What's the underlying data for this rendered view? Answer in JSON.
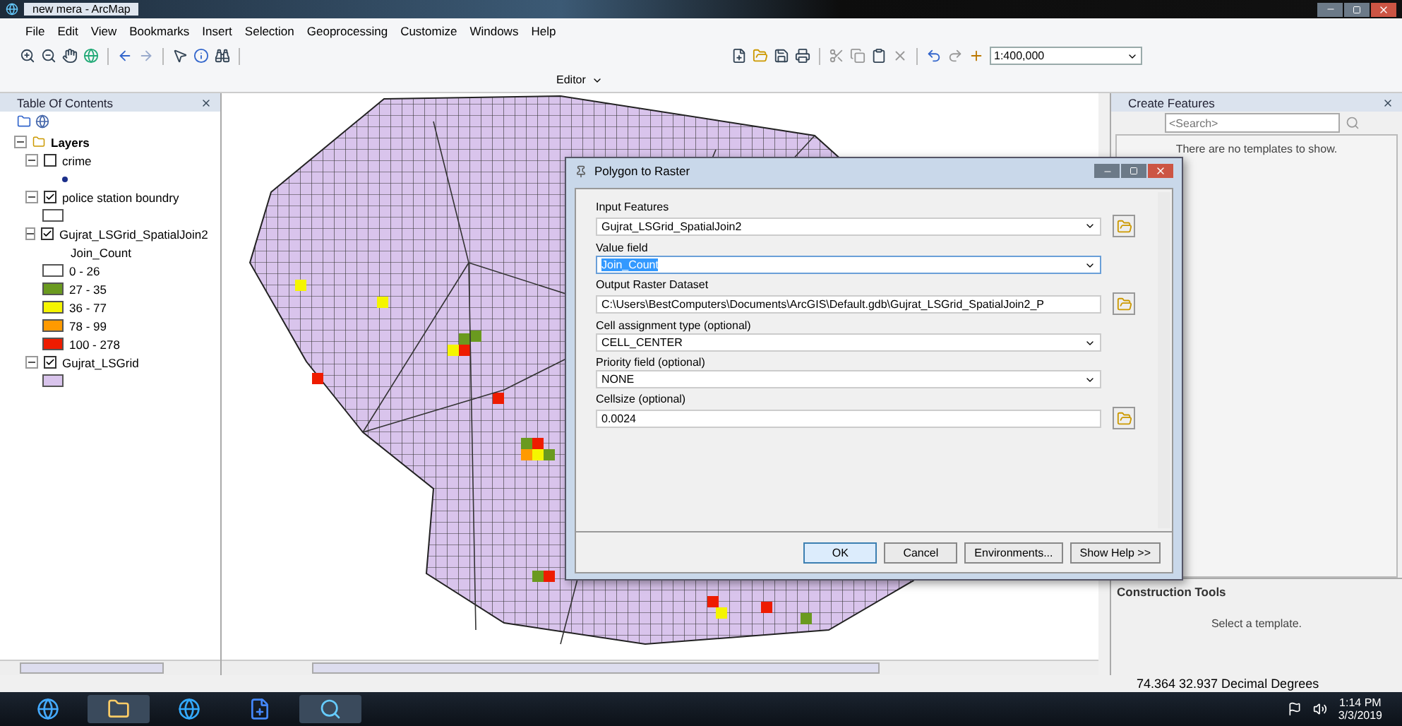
{
  "window": {
    "title": "new mera - ArcMap"
  },
  "menu": [
    "File",
    "Edit",
    "View",
    "Bookmarks",
    "Insert",
    "Selection",
    "Geoprocessing",
    "Customize",
    "Windows",
    "Help"
  ],
  "toolbar": {
    "scale": "1:400,000"
  },
  "editor_toolbar": {
    "label": "Editor"
  },
  "toc": {
    "title": "Table Of Contents",
    "root": {
      "label": "Layers",
      "expanded": true,
      "children": [
        {
          "label": "crime",
          "checked": false,
          "legend": [
            {
              "kind": "point",
              "color": "#1b2f8a"
            }
          ]
        },
        {
          "label": "police station boundry",
          "checked": true,
          "legend": [
            {
              "kind": "outline",
              "color": "#ffffff"
            }
          ]
        },
        {
          "label": "Gujrat_LSGrid_SpatialJoin2",
          "checked": true,
          "field": "Join_Count",
          "legend": [
            {
              "kind": "fill",
              "label": "0 - 26",
              "color": "#ffffff"
            },
            {
              "kind": "fill",
              "label": "27 - 35",
              "color": "#6a9a1f"
            },
            {
              "kind": "fill",
              "label": "36 - 77",
              "color": "#f5f500"
            },
            {
              "kind": "fill",
              "label": "78 - 99",
              "color": "#ff9a00"
            },
            {
              "kind": "fill",
              "label": "100 - 278",
              "color": "#ee1c00"
            }
          ]
        },
        {
          "label": "Gujrat_LSGrid",
          "checked": true,
          "legend": [
            {
              "kind": "fill",
              "color": "#d9c4ec"
            }
          ]
        }
      ]
    }
  },
  "dialog": {
    "title": "Polygon to Raster",
    "fields": [
      {
        "label": "Input Features",
        "value": "Gujrat_LSGrid_SpatialJoin2",
        "kind": "dropdown",
        "browse": true,
        "text_selected": false
      },
      {
        "label": "Value field",
        "value": "Join_Count",
        "kind": "dropdown",
        "browse": false,
        "text_selected": true
      },
      {
        "label": "Output Raster Dataset",
        "value": "C:\\Users\\BestComputers\\Documents\\ArcGIS\\Default.gdb\\Gujrat_LSGrid_SpatialJoin2_P",
        "kind": "text",
        "browse": true,
        "text_selected": false
      },
      {
        "label": "Cell assignment type (optional)",
        "value": "CELL_CENTER",
        "kind": "dropdown",
        "browse": false,
        "text_selected": false
      },
      {
        "label": "Priority field (optional)",
        "value": "NONE",
        "kind": "dropdown",
        "browse": false,
        "text_selected": false
      },
      {
        "label": "Cellsize (optional)",
        "value": "0.0024",
        "kind": "text",
        "browse": true,
        "text_selected": false
      }
    ],
    "buttons": [
      {
        "label": "OK",
        "default": true
      },
      {
        "label": "Cancel",
        "default": false
      },
      {
        "label": "Environments...",
        "default": false
      },
      {
        "label": "Show Help >>",
        "default": false
      }
    ]
  },
  "create_features": {
    "title": "Create Features",
    "search": {
      "placeholder": "<Search>"
    },
    "message": "There are no templates to show.",
    "construction_title": "Construction Tools",
    "construction_message": "Select a template."
  },
  "status_bar": {
    "coordinates": "74.364  32.937 Decimal Degrees"
  },
  "taskbar": {
    "time": "1:14 PM",
    "date": "3/3/2019"
  }
}
